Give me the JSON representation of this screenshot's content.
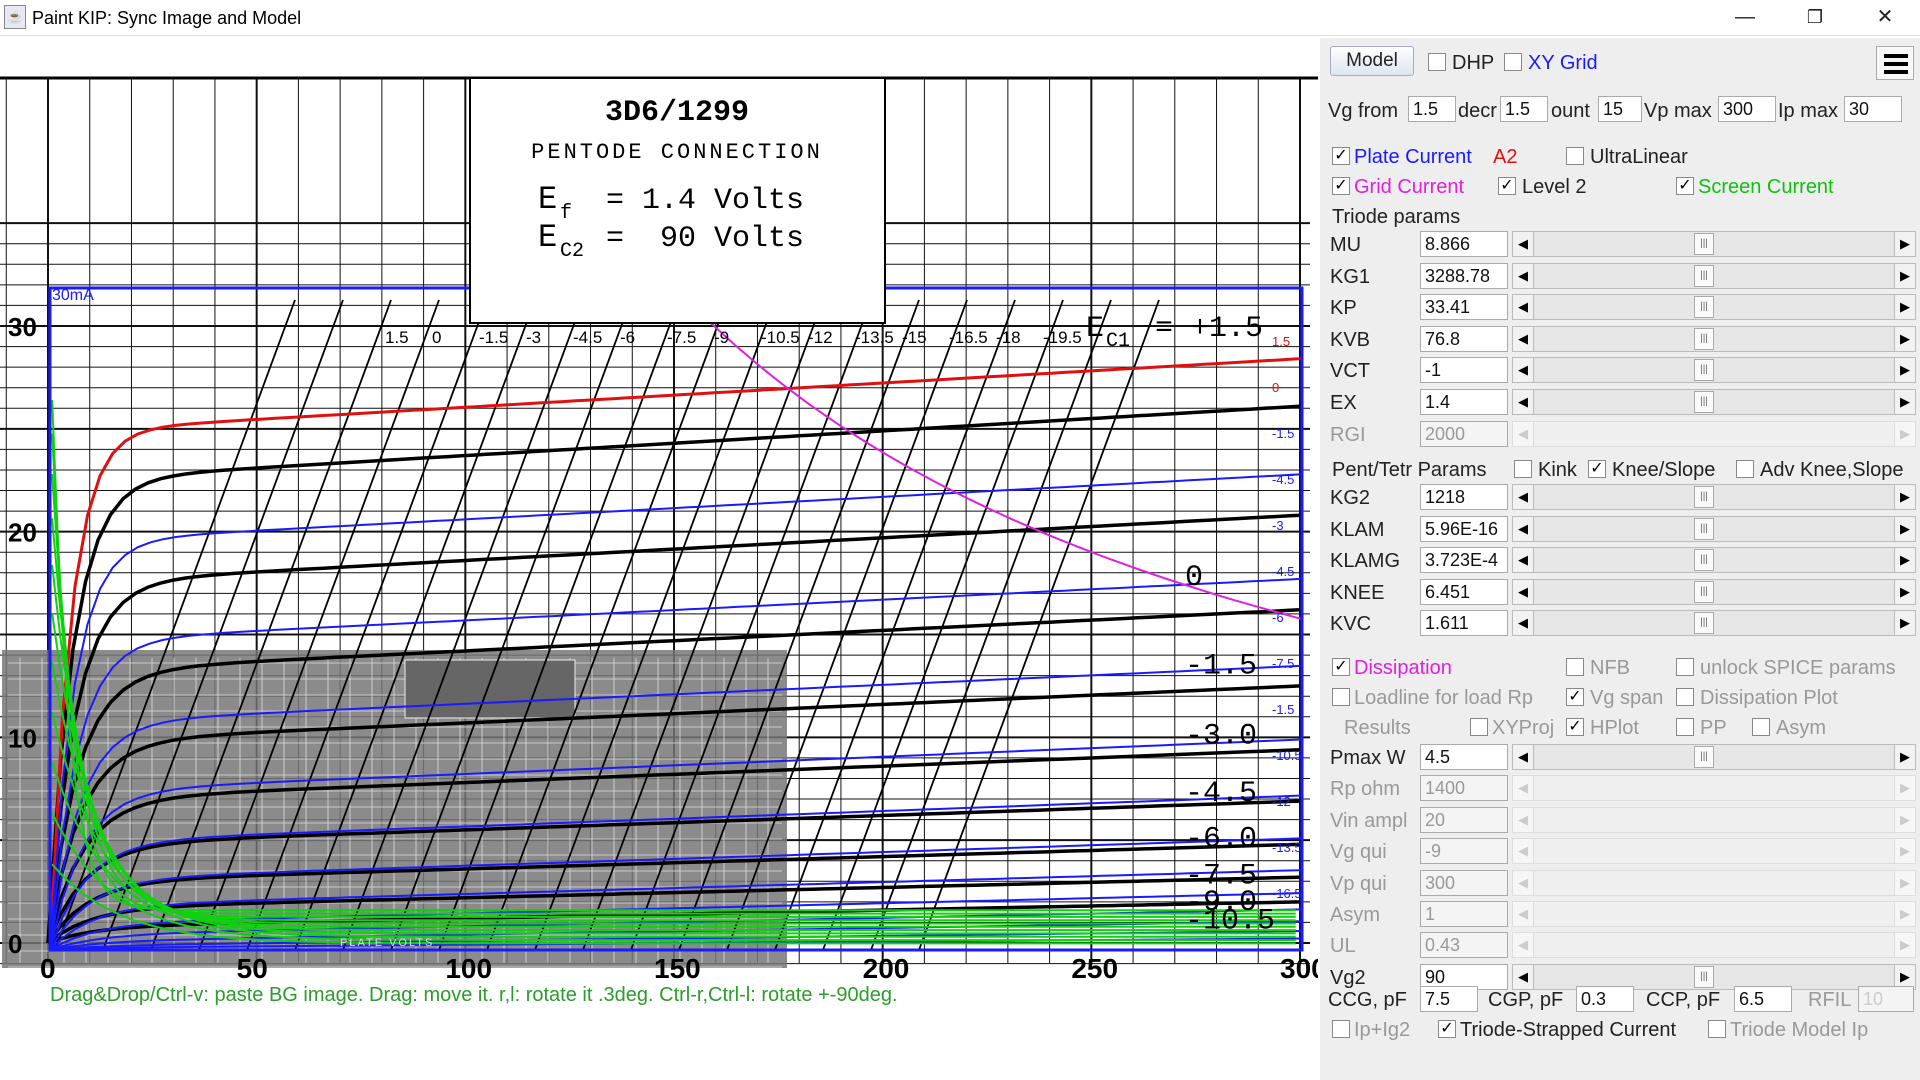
{
  "window": {
    "title": "Paint KIP: Sync Image and Model",
    "icon": "java-cup-icon",
    "minimize": "—",
    "restore": "❐",
    "close": "✕"
  },
  "graph": {
    "plate_axis_label": "PLATE VOLTS",
    "title_box": {
      "line1": "3D6/1299",
      "line2": "PENTODE CONNECTION",
      "line3_lhs": "E",
      "line3_sub": "f",
      "line3_rhs": "= 1.4 Volts",
      "line4_lhs": "E",
      "line4_sub": "C2",
      "line4_rhs": "=  90 Volts"
    },
    "ec1_label": "E",
    "ec1_sub": "C1",
    "ec1_rhs": "= +1.5",
    "y_ticks": [
      "30",
      "20",
      "10",
      "0"
    ],
    "x_ticks": [
      "0",
      "50",
      "100",
      "150",
      "200",
      "250",
      "300"
    ],
    "curve_labels": [
      "0",
      "-1.5",
      "-3.0",
      "-4.5",
      "-6.0",
      "-7.5",
      "-9.0",
      "-10.5"
    ],
    "model_y_label": "30mA",
    "vg_top_labels": [
      "1.5",
      "0",
      "-1.5",
      "-3",
      "-4.5",
      "-6",
      "-7.5",
      "-9",
      "-10.5",
      "-12",
      "-13.5",
      "-15",
      "-16.5",
      "-18",
      "-19.5"
    ],
    "right_small_labels": [
      "1.5",
      "0",
      "-1.5",
      "-4.5",
      "-3",
      "-4.5",
      "-6",
      "-7.5",
      "-1.5",
      "-10.5",
      "-12",
      "-13.5",
      "-16.5"
    ],
    "help_text": "Drag&Drop/Ctrl-v: paste BG image. Drag: move it. r,l: rotate it .3deg. Ctrl-r,Ctrl-l: rotate +-90deg."
  },
  "panel": {
    "model_button": "Model",
    "dhp": {
      "label": "DHP",
      "checked": false
    },
    "xy_grid": {
      "label": "XY Grid",
      "checked": false
    },
    "menu_icon": "hamburger-menu-icon",
    "vg_row": {
      "vg_from_label": "Vg from",
      "vg_from": "1.5",
      "decr_label": "decr",
      "decr": "1.5",
      "count_label": "ount",
      "count": "15",
      "vpmax_label": "Vp max",
      "vpmax": "300",
      "ipmax_label": "Ip max",
      "ipmax": "30"
    },
    "plate_current": {
      "label": "Plate Current",
      "checked": true,
      "extra": "A2"
    },
    "ultralinear": {
      "label": "UltraLinear",
      "checked": false
    },
    "grid_current": {
      "label": "Grid Current",
      "checked": true
    },
    "level2": {
      "label": "Level 2",
      "checked": true
    },
    "screen_current": {
      "label": "Screen Current",
      "checked": true
    },
    "triode_header": "Triode params",
    "triode_params": [
      {
        "label": "MU",
        "value": "8.866",
        "disabled": false
      },
      {
        "label": "KG1",
        "value": "3288.78",
        "disabled": false
      },
      {
        "label": "KP",
        "value": "33.41",
        "disabled": false
      },
      {
        "label": "KVB",
        "value": "76.8",
        "disabled": false
      },
      {
        "label": "VCT",
        "value": "-1",
        "disabled": false
      },
      {
        "label": "EX",
        "value": "1.4",
        "disabled": false
      },
      {
        "label": "RGI",
        "value": "2000",
        "disabled": true
      }
    ],
    "pent_header": "Pent/Tetr Params",
    "kink": {
      "label": "Kink",
      "checked": false
    },
    "knee_slope": {
      "label": "Knee/Slope",
      "checked": true
    },
    "adv_knee": {
      "label": "Adv Knee,Slope",
      "checked": false
    },
    "pent_params": [
      {
        "label": "KG2",
        "value": "1218",
        "disabled": false
      },
      {
        "label": "KLAM",
        "value": "5.96E-16",
        "disabled": false
      },
      {
        "label": "KLAMG",
        "value": "3.723E-4",
        "disabled": false
      },
      {
        "label": "KNEE",
        "value": "6.451",
        "disabled": false
      },
      {
        "label": "KVC",
        "value": "1.611",
        "disabled": false
      }
    ],
    "dissipation": {
      "label": "Dissipation",
      "checked": true
    },
    "nfb": {
      "label": "NFB",
      "checked": false
    },
    "unlock_spice": {
      "label": "unlock SPICE params",
      "checked": false
    },
    "loadline": {
      "label": "Loadline for load Rp",
      "checked": false
    },
    "vg_span": {
      "label": "Vg span",
      "checked": true
    },
    "dissipation_plot": {
      "label": "Dissipation Plot",
      "checked": false
    },
    "results_label": "Results",
    "xyproj": {
      "label": "XYProj",
      "checked": false
    },
    "hplot": {
      "label": "HPlot",
      "checked": true
    },
    "pp": {
      "label": "PP",
      "checked": false
    },
    "asym_cb": {
      "label": "Asym",
      "checked": false
    },
    "load_params": [
      {
        "label": "Pmax W",
        "value": "4.5",
        "disabled": false
      },
      {
        "label": "Rp ohm",
        "value": "1400",
        "disabled": true
      },
      {
        "label": "Vin ampl",
        "value": "20",
        "disabled": true
      },
      {
        "label": "Vg qui",
        "value": "-9",
        "disabled": true
      },
      {
        "label": "Vp qui",
        "value": "300",
        "disabled": true
      },
      {
        "label": "Asym",
        "value": "1",
        "disabled": true
      },
      {
        "label": "UL",
        "value": "0.43",
        "disabled": true
      },
      {
        "label": "Vg2",
        "value": "90",
        "disabled": false
      }
    ],
    "caps": {
      "ccg_label": "CCG, pF",
      "ccg": "7.5",
      "cgp_label": "CGP, pF",
      "cgp": "0.3",
      "ccp_label": "CCP, pF",
      "ccp": "6.5",
      "rfil_label": "RFIL",
      "rfil": "10"
    },
    "ip_ig2": {
      "label": "Ip+Ig2",
      "checked": false
    },
    "triode_strapped": {
      "label": "Triode-Strapped Current",
      "checked": true
    },
    "triode_model_ip": {
      "label": "Triode Model Ip",
      "checked": false
    }
  }
}
